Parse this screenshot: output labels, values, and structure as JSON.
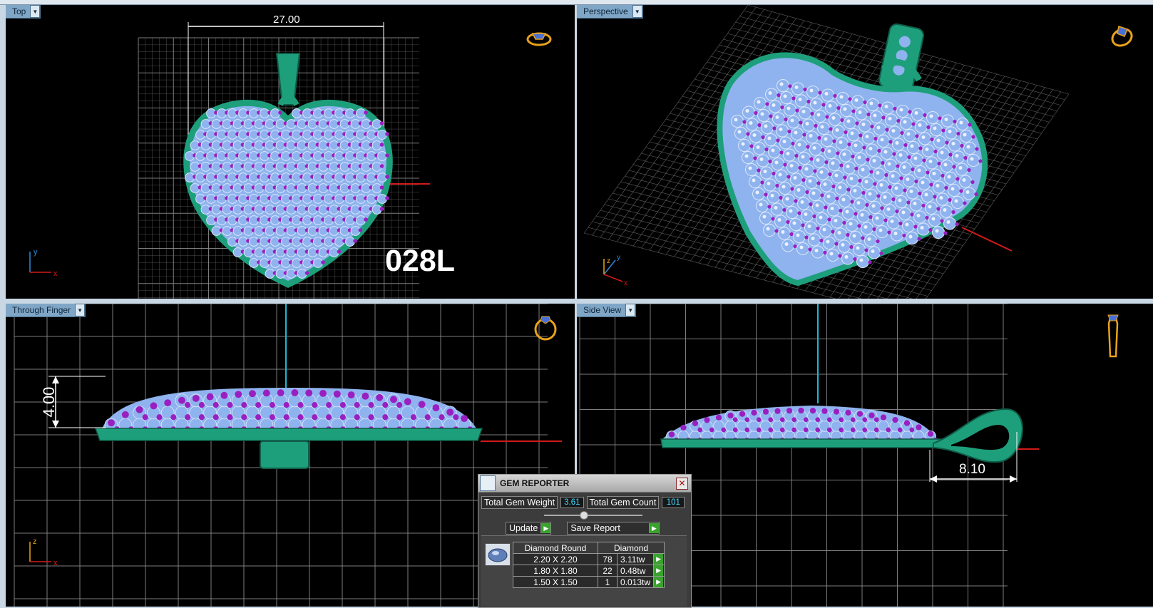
{
  "viewports": {
    "top": {
      "label": "Top",
      "dimension": "27.00",
      "code": "028L"
    },
    "perspective": {
      "label": "Perspective"
    },
    "finger": {
      "label": "Through Finger",
      "dimension": "4.00"
    },
    "side": {
      "label": "Side View",
      "dimension": "8.10"
    }
  },
  "axis": {
    "x": "x",
    "y": "y",
    "z": "z"
  },
  "colors": {
    "metal": "#1e9f7c",
    "gem": "#8fb3ee",
    "prong": "#9a1fc0",
    "grid": "#8a8a8a",
    "cursor": "#19b9d6",
    "xaxis": "#d11a1a"
  },
  "gem_reporter": {
    "title": "GEM REPORTER",
    "total_weight_label": "Total Gem Weight",
    "total_weight": "3.61",
    "total_count_label": "Total Gem Count",
    "total_count": "101",
    "update_label": "Update",
    "save_label": "Save Report",
    "close_glyph": "✕",
    "header_shape": "Diamond Round",
    "header_material": "Diamond",
    "rows": [
      {
        "size": "2.20 X 2.20",
        "count": "78",
        "weight": "3.11tw"
      },
      {
        "size": "1.80 X 1.80",
        "count": "22",
        "weight": "0.48tw"
      },
      {
        "size": "1.50 X 1.50",
        "count": "1",
        "weight": "0.013tw"
      }
    ]
  }
}
